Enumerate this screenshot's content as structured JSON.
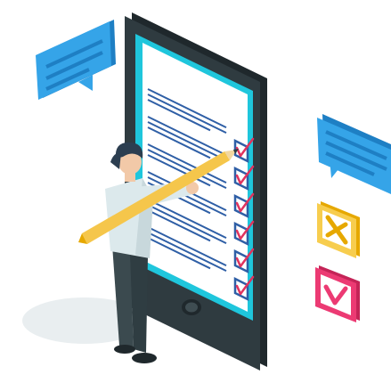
{
  "colors": {
    "phone_body": "#2f3b40",
    "phone_edge": "#1f282c",
    "screen_bezel": "#1fc6dc",
    "screen_paper": "#ffffff",
    "text_lines": "#2f5fa6",
    "checkbox": "#2f5fa6",
    "checkmark": "#e0335e",
    "bubble": "#35a4e8",
    "bubble_dark": "#1e7fc4",
    "x_icon_border": "#f7cd4e",
    "x_icon_mark": "#e6a800",
    "check_icon_border": "#ec3a73",
    "person_shirt": "#dce9ec",
    "person_pants": "#3b4a4f",
    "person_hair": "#2c3e50",
    "pencil": "#f5c64b"
  },
  "icons": {
    "bubble_left": "speech-bubble-icon",
    "bubble_right": "speech-bubble-icon",
    "reject": "x-mark-icon",
    "approve": "check-mark-icon",
    "pencil": "pencil-icon"
  },
  "checklist": {
    "checked_count": 6,
    "total_count": 6
  }
}
